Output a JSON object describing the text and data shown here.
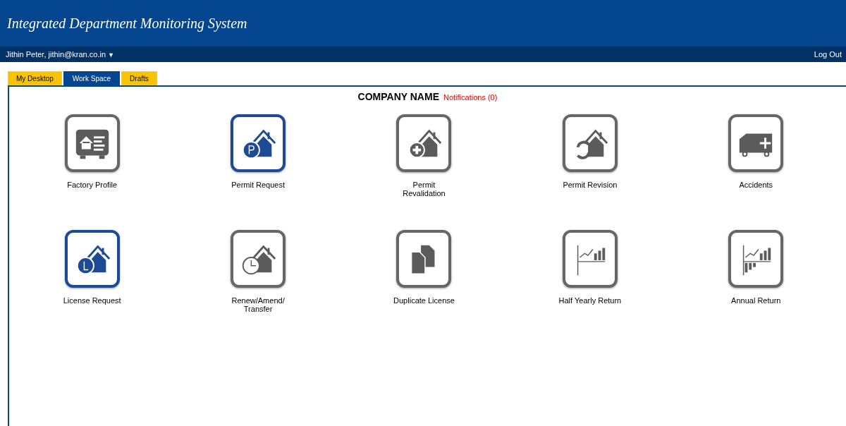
{
  "header": {
    "title": "Integrated Department Monitoring System"
  },
  "user_bar": {
    "user": "Jithin Peter, jithin@kran.co.in",
    "caret": "▼",
    "logout": "Log Out"
  },
  "tabs": [
    {
      "label": "My Desktop",
      "selected": false
    },
    {
      "label": "Work Space",
      "selected": true
    },
    {
      "label": "Drafts",
      "selected": false
    }
  ],
  "panel": {
    "company": "COMPANY NAME",
    "notifications": "Notifications (0)"
  },
  "tiles": [
    {
      "label": "Factory Profile",
      "kind": "factory",
      "highlighted": false
    },
    {
      "label": "Permit Request",
      "kind": "permit",
      "highlighted": true
    },
    {
      "label": "Permit Revalidation",
      "kind": "revalidation",
      "highlighted": false
    },
    {
      "label": "Permit Revision",
      "kind": "revision",
      "highlighted": false
    },
    {
      "label": "Accidents",
      "kind": "ambulance",
      "highlighted": false
    },
    {
      "label": "License Request",
      "kind": "license",
      "highlighted": true
    },
    {
      "label": "Renew/Amend/ Transfer",
      "kind": "renew",
      "highlighted": false
    },
    {
      "label": "Duplicate License",
      "kind": "duplicate",
      "highlighted": false
    },
    {
      "label": "Half Yearly Return",
      "kind": "halfyearly",
      "highlighted": false
    },
    {
      "label": "Annual Return",
      "kind": "annual",
      "highlighted": false
    }
  ]
}
